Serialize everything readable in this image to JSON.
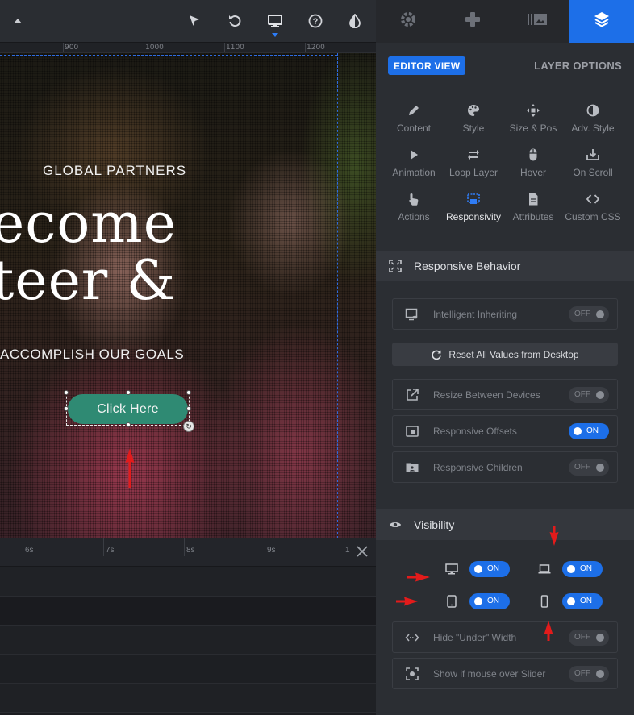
{
  "toolbar": {
    "icons": [
      "chevron-up-icon",
      "cursor-icon",
      "undo-icon",
      "desktop-icon",
      "help-icon",
      "contrast-icon"
    ]
  },
  "ruler": {
    "labels": [
      "900",
      "1000",
      "1100",
      "1200"
    ]
  },
  "canvas": {
    "subtitle": "GLOBAL PARTNERS",
    "heading_line1": "ecome",
    "heading_line2": "teer &",
    "tagline": "ACCOMPLISH OUR GOALS",
    "button_label": "Click Here",
    "button_color": "#2f8a73"
  },
  "timeline": {
    "labels": [
      "6s",
      "7s",
      "8s",
      "9s",
      "1"
    ]
  },
  "panel": {
    "tabs": [
      "settings-icon",
      "modules-icon",
      "media-icon",
      "layers-icon"
    ],
    "editor_view": "EDITOR VIEW",
    "layer_options": "LAYER OPTIONS",
    "options": [
      {
        "label": "Content",
        "icon": "pen-icon"
      },
      {
        "label": "Style",
        "icon": "palette-icon"
      },
      {
        "label": "Size & Pos",
        "icon": "move-icon"
      },
      {
        "label": "Adv. Style",
        "icon": "contrast-icon"
      },
      {
        "label": "Animation",
        "icon": "play-icon"
      },
      {
        "label": "Loop Layer",
        "icon": "loop-icon"
      },
      {
        "label": "Hover",
        "icon": "mouse-icon"
      },
      {
        "label": "On Scroll",
        "icon": "scroll-icon"
      },
      {
        "label": "Actions",
        "icon": "hand-icon"
      },
      {
        "label": "Responsivity",
        "icon": "responsive-icon"
      },
      {
        "label": "Attributes",
        "icon": "document-icon"
      },
      {
        "label": "Custom CSS",
        "icon": "code-icon"
      }
    ],
    "responsive": {
      "title": "Responsive Behavior",
      "intelligent_inheriting": {
        "label": "Intelligent Inheriting",
        "state": "OFF"
      },
      "reset": "Reset All Values from Desktop",
      "resize_between_devices": {
        "label": "Resize Between Devices",
        "state": "OFF"
      },
      "responsive_offsets": {
        "label": "Responsive Offsets",
        "state": "ON"
      },
      "responsive_children": {
        "label": "Responsive Children",
        "state": "OFF"
      }
    },
    "visibility": {
      "title": "Visibility",
      "desktop": "ON",
      "laptop": "ON",
      "tablet": "ON",
      "mobile": "ON",
      "hide_under_width": {
        "label": "Hide \"Under\" Width",
        "state": "OFF"
      },
      "show_mouse_over": {
        "label": "Show if mouse over Slider",
        "state": "OFF"
      }
    }
  },
  "colors": {
    "accent": "#1d6fe8",
    "annotation_arrow": "#e31b1b"
  }
}
